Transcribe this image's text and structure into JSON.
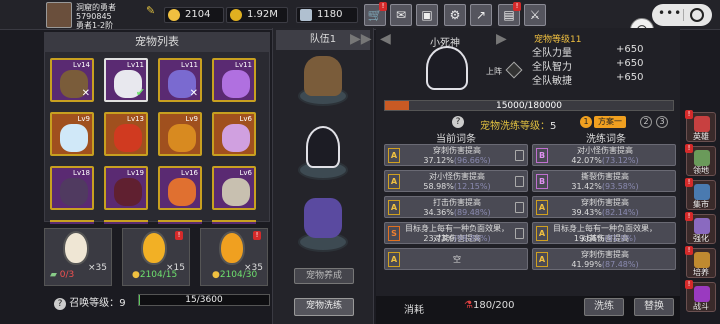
{
  "player": {
    "name": "洞窟的勇者",
    "id": "5790845",
    "rank": "勇者1-2阶"
  },
  "resources": [
    {
      "name": "egg",
      "value": "2104",
      "icon": "egg-icon",
      "color": "#f0c040"
    },
    {
      "name": "gold",
      "value": "1.92M",
      "icon": "gold-coin-icon",
      "color": "#e0b020"
    },
    {
      "name": "gem",
      "value": "1180",
      "icon": "gem-icon",
      "color": "#b0c0d0"
    }
  ],
  "pet_list": {
    "title": "宠物列表",
    "pets": [
      {
        "lv": "Lv14",
        "kind": "treant",
        "bg": "purple",
        "mark": "x"
      },
      {
        "lv": "Lv11",
        "kind": "reaper",
        "bg": "purple",
        "mark": "check",
        "selected": true
      },
      {
        "lv": "Lv11",
        "kind": "unicorn",
        "bg": "purple",
        "mark": "x"
      },
      {
        "lv": "Lv11",
        "kind": "scorpion",
        "bg": "purple",
        "mark": ""
      },
      {
        "lv": "Lv9",
        "kind": "ice-beast",
        "bg": "orange",
        "mark": ""
      },
      {
        "lv": "Lv13",
        "kind": "fire-beast",
        "bg": "orange",
        "mark": ""
      },
      {
        "lv": "Lv9",
        "kind": "spider",
        "bg": "orange",
        "mark": ""
      },
      {
        "lv": "Lv6",
        "kind": "crystal",
        "bg": "orange",
        "mark": ""
      },
      {
        "lv": "Lv18",
        "kind": "bat",
        "bg": "purple",
        "mark": ""
      },
      {
        "lv": "Lv19",
        "kind": "demon",
        "bg": "purple",
        "mark": ""
      },
      {
        "lv": "Lv16",
        "kind": "flame",
        "bg": "purple",
        "mark": ""
      },
      {
        "lv": "Lv6",
        "kind": "skull",
        "bg": "purple",
        "mark": ""
      }
    ]
  },
  "eggs": [
    {
      "count": "×35",
      "sub": "0/3"
    },
    {
      "count": "×15",
      "sub": "2104/15"
    },
    {
      "count": "×35",
      "sub": "2104/30"
    }
  ],
  "summon": {
    "label": "召唤等级：",
    "level": "9",
    "progress_text": "15/3600",
    "progress": 0.004
  },
  "team": {
    "title": "队伍1",
    "btn_pet_form": "宠物养成",
    "btn_pet_wash": "宠物洗练"
  },
  "pet_detail": {
    "name": "小死神",
    "level_text": "宠物等级11",
    "battle_label": "上阵",
    "stats": [
      {
        "label": "全队力量",
        "value": "+650"
      },
      {
        "label": "全队智力",
        "value": "+650"
      },
      {
        "label": "全队敏捷",
        "value": "+650"
      }
    ],
    "xp_text": "15000/180000",
    "xp": 0.083
  },
  "wash": {
    "level_text": "宠物洗练等级：",
    "level": "5",
    "plans": [
      "1",
      "方案一",
      "2",
      "3"
    ]
  },
  "current_title": "当前词条",
  "wash_title": "洗练词条",
  "current_entries": [
    {
      "grade": "A",
      "name": "穿刺伤害提高",
      "value": "37.12%",
      "pct": "(96.66%)"
    },
    {
      "grade": "A",
      "name": "对小怪伤害提高",
      "value": "58.98%",
      "pct": "(12.15%)"
    },
    {
      "grade": "A",
      "name": "打击伤害提高",
      "value": "34.36%",
      "pct": "(89.48%)"
    },
    {
      "grade": "S",
      "name": "目标身上每有一种负面效果，对其伤害提高",
      "value": "23.73%",
      "pct": "(98.89%)"
    },
    {
      "grade": "A",
      "name": "空",
      "value": "",
      "pct": ""
    }
  ],
  "wash_entries": [
    {
      "grade": "B",
      "name": "对小怪伤害提高",
      "value": "42.07%",
      "pct": "(73.12%)"
    },
    {
      "grade": "B",
      "name": "撕裂伤害提高",
      "value": "31.42%",
      "pct": "(93.58%)"
    },
    {
      "grade": "A",
      "name": "穿刺伤害提高",
      "value": "39.43%",
      "pct": "(82.14%)"
    },
    {
      "grade": "A",
      "name": "目标身上每有一种负面效果，对其伤害提高",
      "value": "19.66%",
      "pct": "(81.9%)"
    },
    {
      "grade": "A",
      "name": "穿刺伤害提高",
      "value": "41.99%",
      "pct": "(87.48%)"
    }
  ],
  "bottom": {
    "consume_label": "消耗",
    "consume_value": "180/200",
    "btn_wash": "洗练",
    "btn_replace": "替换"
  },
  "side_menu": [
    "英雄",
    "领地",
    "集市",
    "强化",
    "培养",
    "战斗"
  ]
}
